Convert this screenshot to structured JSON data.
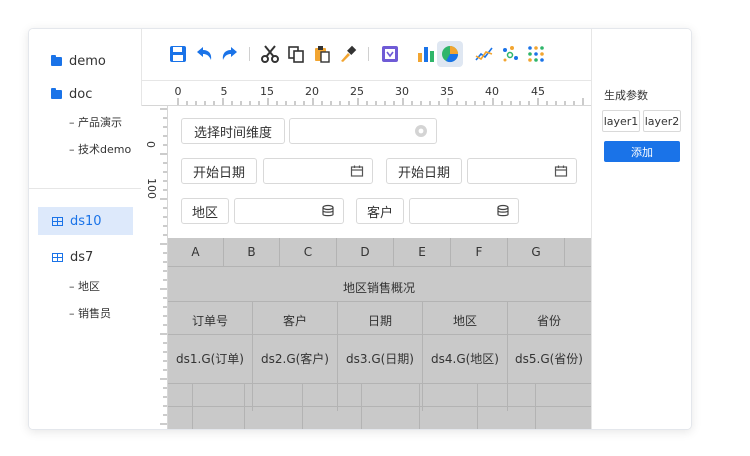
{
  "tree": {
    "folders": [
      {
        "label": "demo"
      },
      {
        "label": "doc",
        "children": [
          "产品演示",
          "技术demo"
        ]
      }
    ],
    "datasets": [
      {
        "label": "ds10",
        "selected": true
      },
      {
        "label": "ds7",
        "children": [
          "地区",
          "销售员"
        ]
      }
    ]
  },
  "toolbar": {
    "icons": [
      "save-icon",
      "undo-icon",
      "redo-icon",
      "cut-icon",
      "copy-icon",
      "paste-icon",
      "format-brush-icon",
      "filter-form-icon",
      "bar-chart-icon",
      "pie-chart-icon",
      "line-chart-icon",
      "scatter-chart-icon",
      "heatmap-chart-icon"
    ],
    "active": "pie-chart-icon"
  },
  "ruler": {
    "horizontal": [
      "0",
      "5",
      "15",
      "20",
      "25",
      "30",
      "35",
      "40",
      "45"
    ],
    "vertical": [
      "0",
      "100"
    ]
  },
  "form": {
    "dimension_label": "选择时间维度",
    "start_date_label_1": "开始日期",
    "start_date_label_2": "开始日期",
    "region_label": "地区",
    "customer_label": "客户"
  },
  "grid": {
    "columns": [
      "A",
      "B",
      "C",
      "D",
      "E",
      "F",
      "G"
    ],
    "title": "地区销售概况",
    "headers": [
      "订单号",
      "客户",
      "日期",
      "地区",
      "省份"
    ],
    "cells": [
      "ds1.G(订单)",
      "ds2.G(客户)",
      "ds3.G(日期)",
      "ds4.G(地区)",
      "ds5.G(省份)"
    ]
  },
  "right_panel": {
    "title": "生成参数",
    "layers": [
      "layer1",
      "layer2"
    ],
    "add_label": "添加"
  },
  "colors": {
    "accent": "#1a73e8",
    "selection": "#dde9fb",
    "grid_bg": "#c9c9c9"
  }
}
